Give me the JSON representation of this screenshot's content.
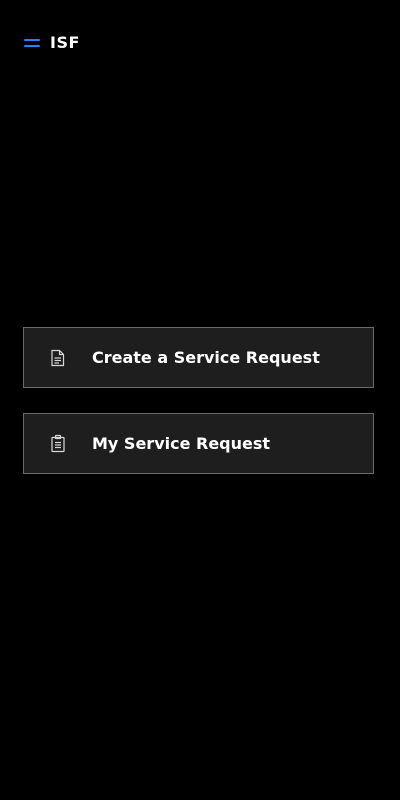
{
  "header": {
    "menu_icon": "hamburger-menu-icon",
    "title": "ISF"
  },
  "actions": [
    {
      "label": "Create a Service Request",
      "icon": "document-icon"
    },
    {
      "label": "My Service Request",
      "icon": "clipboard-icon"
    }
  ],
  "colors": {
    "background": "#000000",
    "accent": "#2a7fff",
    "card_background": "#1e1e1e",
    "card_border": "#6a6a6a",
    "text": "#ffffff"
  }
}
